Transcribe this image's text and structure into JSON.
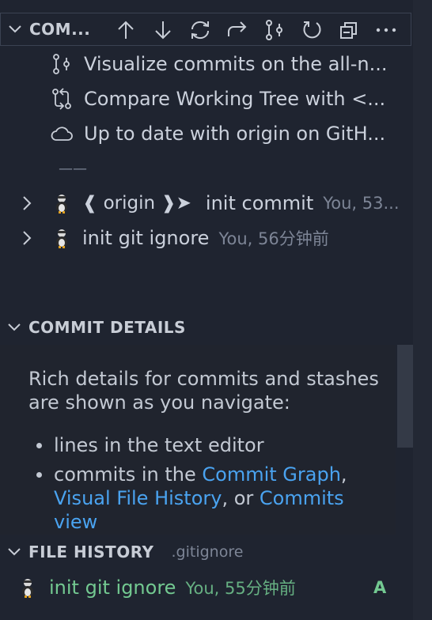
{
  "commits_view": {
    "title": "COM...",
    "toolbar_icons": [
      "arrow-up-icon",
      "arrow-down-icon",
      "refresh-icon",
      "redo-icon",
      "graph-icon",
      "reload-icon",
      "collapse-all-icon",
      "ellipsis-icon"
    ],
    "rows": [
      {
        "icon": "graph-icon",
        "label": "Visualize commits on the all-n..."
      },
      {
        "icon": "compare-icon",
        "label": "Compare Working Tree with <..."
      },
      {
        "icon": "cloud-icon",
        "label": "Up to date with origin on GitH..."
      }
    ],
    "separator": "——",
    "commits": [
      {
        "tag": "❰ origin ❱➤",
        "message": "init commit",
        "meta": "You, 53..."
      },
      {
        "tag": "",
        "message": "init git ignore",
        "meta": "You, 56分钟前"
      }
    ]
  },
  "commit_details": {
    "title": "COMMIT DETAILS",
    "intro": "Rich details for commits and stashes are shown as you navigate:",
    "bullet1": "lines in the text editor",
    "bullet2_prefix": "commits in the ",
    "link_commit_graph": "Commit Graph",
    "comma": ",",
    "link_visual_file_history": "Visual File History",
    "or_text": ", or ",
    "link_commits_view": "Commits view"
  },
  "file_history": {
    "title": "FILE HISTORY",
    "file": ".gitignore",
    "entry": {
      "message": "init git ignore",
      "meta": "You, 55分钟前",
      "status": "A"
    }
  },
  "colors": {
    "background": "#1f2430",
    "accent_link": "#4aa3f0",
    "added_green": "#73c991",
    "focus_border": "#3b4252"
  }
}
